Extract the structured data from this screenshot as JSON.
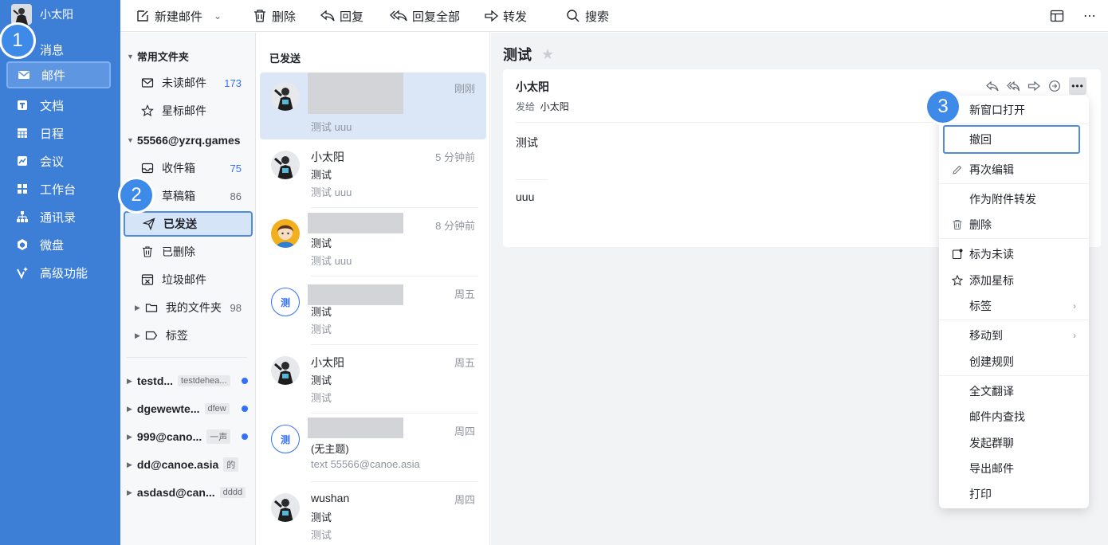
{
  "colors": {
    "nav_bg": "#3d7fd6",
    "accent": "#3370ff",
    "badge": "#3e8ae8"
  },
  "user": {
    "name": "小太阳"
  },
  "nav": {
    "items": [
      {
        "label": "消息",
        "icon": "chat-icon"
      },
      {
        "label": "邮件",
        "icon": "mail-icon",
        "active": true
      },
      {
        "label": "文档",
        "icon": "doc-icon"
      },
      {
        "label": "日程",
        "icon": "calendar-icon"
      },
      {
        "label": "会议",
        "icon": "video-icon"
      },
      {
        "label": "工作台",
        "icon": "grid-icon"
      },
      {
        "label": "通讯录",
        "icon": "org-icon"
      },
      {
        "label": "微盘",
        "icon": "cube-icon"
      },
      {
        "label": "高级功能",
        "icon": "sparkle-icon"
      }
    ]
  },
  "badges": [
    "1",
    "2",
    "3"
  ],
  "toolbar": {
    "compose": "新建邮件",
    "delete": "删除",
    "reply": "回复",
    "reply_all": "回复全部",
    "forward": "转发",
    "search": "搜索"
  },
  "folders": {
    "common_header": "常用文件夹",
    "unread": {
      "label": "未读邮件",
      "count": "173"
    },
    "starred": {
      "label": "星标邮件"
    },
    "account": "55566@yzrq.games",
    "inbox": {
      "label": "收件箱",
      "count": "75"
    },
    "drafts": {
      "label": "草稿箱",
      "count": "86"
    },
    "sent": {
      "label": "已发送"
    },
    "deleted": {
      "label": "已删除"
    },
    "spam": {
      "label": "垃圾邮件"
    },
    "myfolders": {
      "label": "我的文件夹",
      "count": "98"
    },
    "tags": {
      "label": "标签"
    },
    "other_accounts": [
      {
        "name": "testd...",
        "tag": "testdehea...",
        "dot": true
      },
      {
        "name": "dgewewte...",
        "tag": "dfew",
        "dot": true
      },
      {
        "name": "999@cano...",
        "tag": "一声",
        "dot": true
      },
      {
        "name": "dd@canoe.asia",
        "tag": "的",
        "dot": false
      },
      {
        "name": "asdasd@can...",
        "tag": "dddd",
        "dot": false
      }
    ]
  },
  "maillist": {
    "title": "已发送",
    "rows": [
      {
        "sender": "",
        "subject": "",
        "preview": "测试 uuu",
        "time": "刚刚",
        "avatar": "photo"
      },
      {
        "sender": "小太阳",
        "subject": "测试",
        "preview": "测试 uuu",
        "time": "5 分钟前",
        "avatar": "photo"
      },
      {
        "sender": "",
        "subject": "测试",
        "preview": "测试 uuu",
        "time": "8 分钟前",
        "avatar": "cartoon"
      },
      {
        "sender": "",
        "subject": "测试",
        "preview": "测试",
        "time": "周五",
        "avatar": "测"
      },
      {
        "sender": "小太阳",
        "subject": "测试",
        "preview": "测试",
        "time": "周五",
        "avatar": "photo"
      },
      {
        "sender": "",
        "subject": "(无主题)",
        "preview": "text 55566@canoe.asia",
        "time": "周四",
        "avatar": "测"
      },
      {
        "sender": "wushan",
        "subject": "测试",
        "preview": "测试",
        "time": "周四",
        "avatar": "photo"
      }
    ]
  },
  "reader": {
    "subject": "测试",
    "from": "小太阳",
    "to_label": "发给",
    "to": "小太阳",
    "body1": "测试",
    "body2": "uuu"
  },
  "menu": {
    "items": [
      {
        "label": "新窗口打开"
      },
      {
        "label": "撤回",
        "outlined": true
      },
      {
        "label": "再次编辑",
        "icon": "pencil-icon"
      },
      {
        "label": "作为附件转发"
      },
      {
        "label": "删除",
        "icon": "trash-icon"
      },
      {
        "label": "标为未读",
        "icon": "unread-icon"
      },
      {
        "label": "添加星标",
        "icon": "star-icon"
      },
      {
        "label": "标签",
        "chevron": true
      },
      {
        "label": "移动到",
        "chevron": true
      },
      {
        "label": "创建规则"
      },
      {
        "label": "全文翻译"
      },
      {
        "label": "邮件内查找"
      },
      {
        "label": "发起群聊"
      },
      {
        "label": "导出邮件"
      },
      {
        "label": "打印"
      }
    ]
  }
}
